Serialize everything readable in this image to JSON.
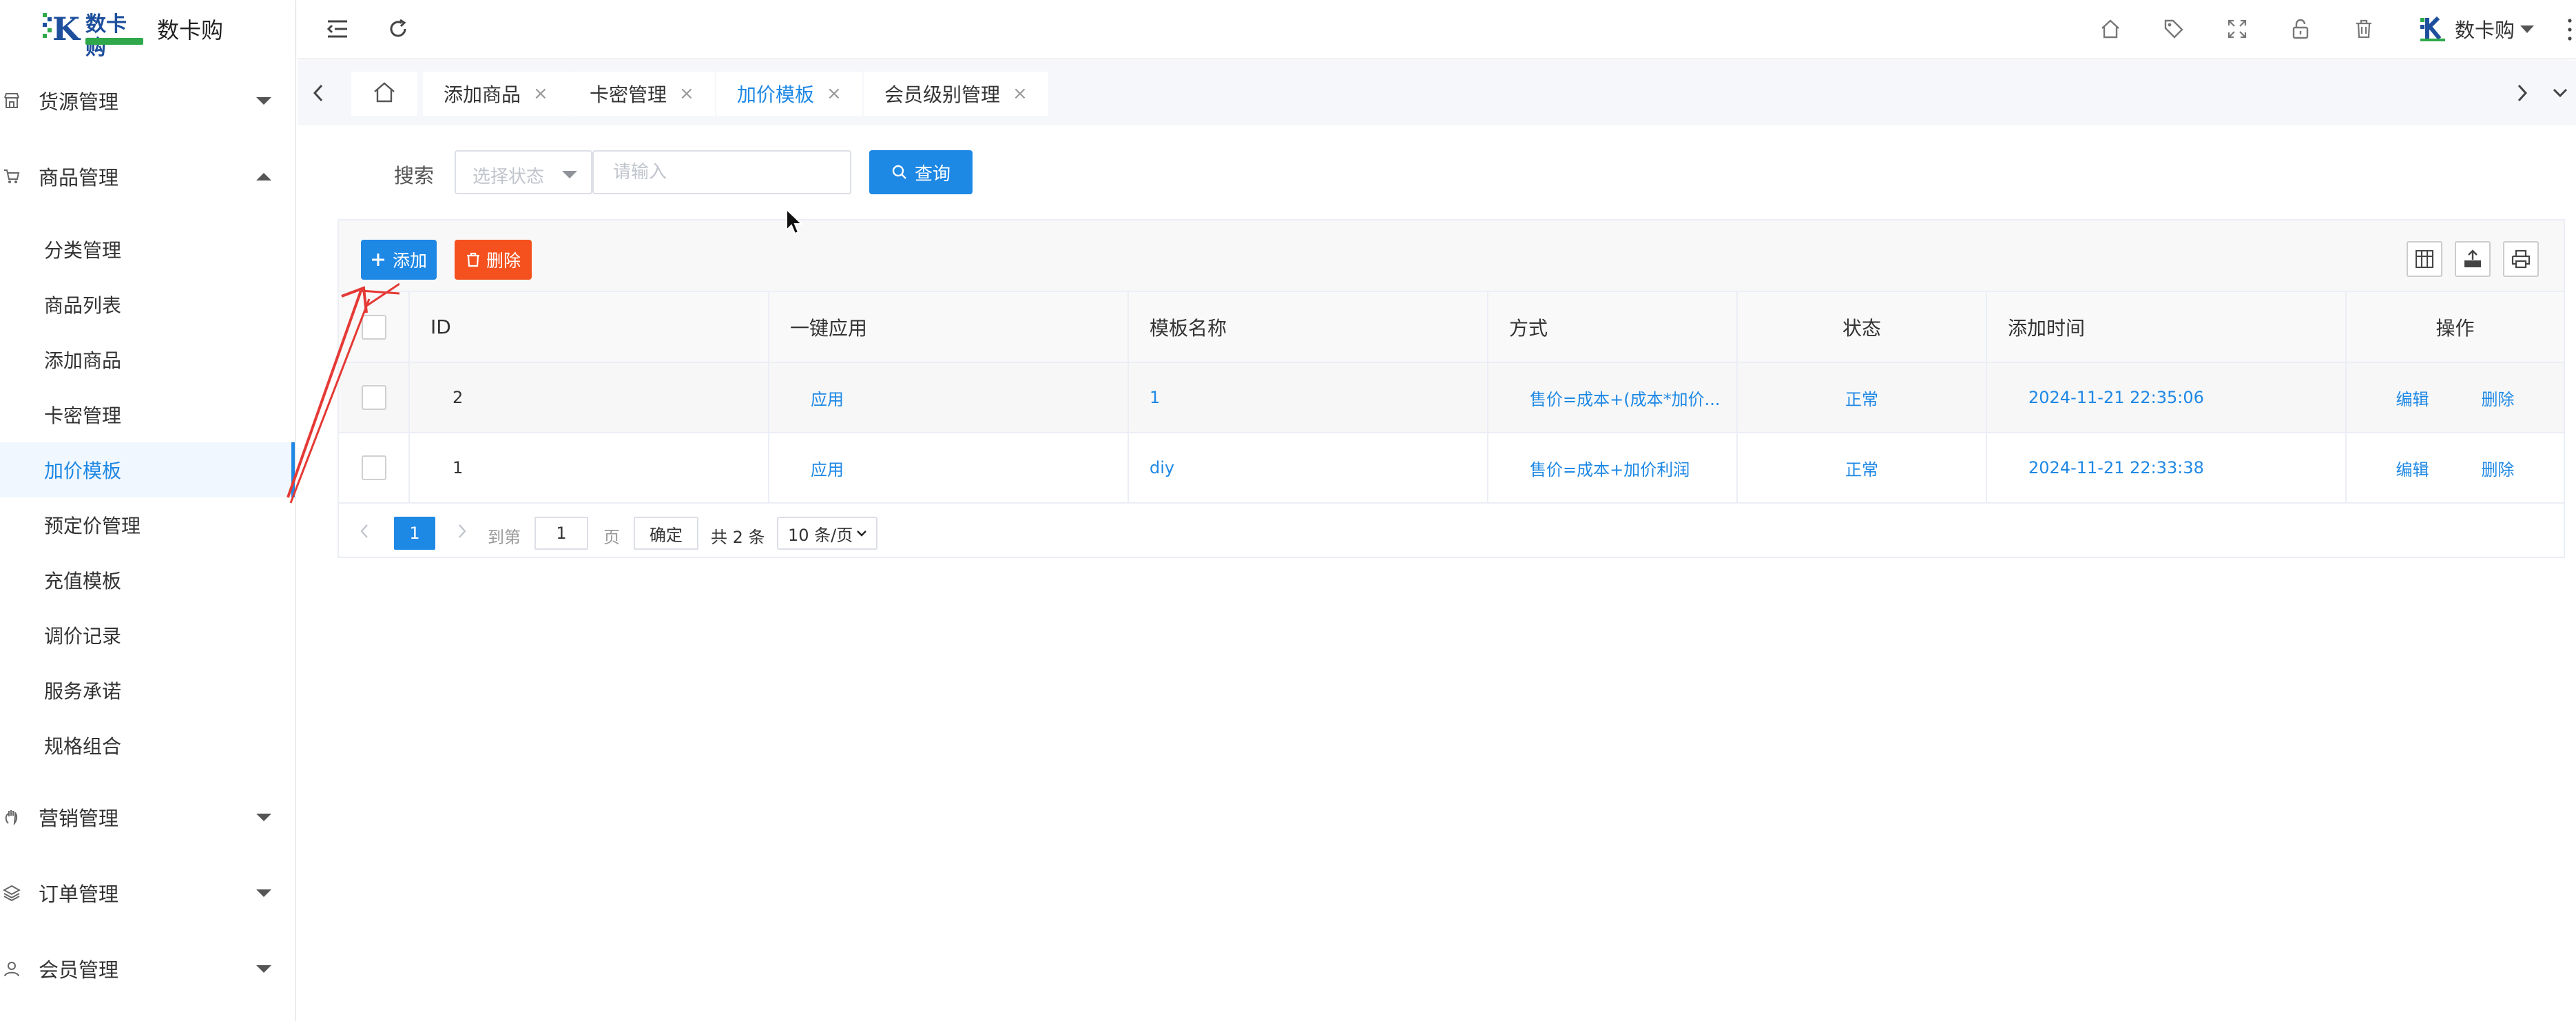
{
  "app": {
    "logo_letter": "K",
    "logo_mark_text": "数卡购",
    "name": "数卡购"
  },
  "sidebar": {
    "groups": [
      {
        "label": "货源管理",
        "icon": "shop-icon",
        "expanded": false
      },
      {
        "label": "商品管理",
        "icon": "cart-icon",
        "expanded": true
      },
      {
        "label": "营销管理",
        "icon": "hand-icon",
        "expanded": false
      },
      {
        "label": "订单管理",
        "icon": "layers-icon",
        "expanded": false
      },
      {
        "label": "会员管理",
        "icon": "user-icon",
        "expanded": false
      }
    ],
    "goods_items": [
      {
        "label": "分类管理"
      },
      {
        "label": "商品列表"
      },
      {
        "label": "添加商品"
      },
      {
        "label": "卡密管理"
      },
      {
        "label": "加价模板",
        "active": true
      },
      {
        "label": "预定价管理"
      },
      {
        "label": "充值模板"
      },
      {
        "label": "调价记录"
      },
      {
        "label": "服务承诺"
      },
      {
        "label": "规格组合"
      }
    ]
  },
  "header": {
    "icons": [
      "menu-fold-icon",
      "refresh-icon",
      "home-icon",
      "tag-icon",
      "fullscreen-icon",
      "unlock-icon",
      "trash-icon"
    ],
    "user_name": "数卡购"
  },
  "tabs": [
    {
      "label": "添加商品",
      "close": "×"
    },
    {
      "label": "卡密管理",
      "close": "×"
    },
    {
      "label": "加价模板",
      "close": "×",
      "active": true
    },
    {
      "label": "会员级别管理",
      "close": "×"
    }
  ],
  "search": {
    "label": "搜索",
    "status_placeholder": "选择状态",
    "input_placeholder": "请输入",
    "query_label": "查询"
  },
  "toolbar": {
    "add_label": "添加",
    "delete_label": "删除",
    "tool_icons": [
      "columns-icon",
      "export-icon",
      "print-icon"
    ]
  },
  "table": {
    "columns": [
      "ID",
      "一键应用",
      "模板名称",
      "方式",
      "状态",
      "添加时间",
      "操作"
    ],
    "rows": [
      {
        "id": "2",
        "apply": "应用",
        "name": "1",
        "method": "售价=成本+(成本*加价...",
        "status": "正常",
        "time": "2024-11-21 22:35:06",
        "edit": "编辑",
        "delete": "删除"
      },
      {
        "id": "1",
        "apply": "应用",
        "name": "diy",
        "method": "售价=成本+加价利润",
        "status": "正常",
        "time": "2024-11-21 22:33:38",
        "edit": "编辑",
        "delete": "删除"
      }
    ]
  },
  "pagination": {
    "current": "1",
    "goto_label": "到第",
    "goto_value": "1",
    "page_unit": "页",
    "confirm": "确定",
    "total": "共 2 条",
    "page_size": "10 条/页"
  },
  "colors": {
    "accent": "#1e88e5",
    "danger": "#f4511e",
    "annotation": "#e53935"
  }
}
